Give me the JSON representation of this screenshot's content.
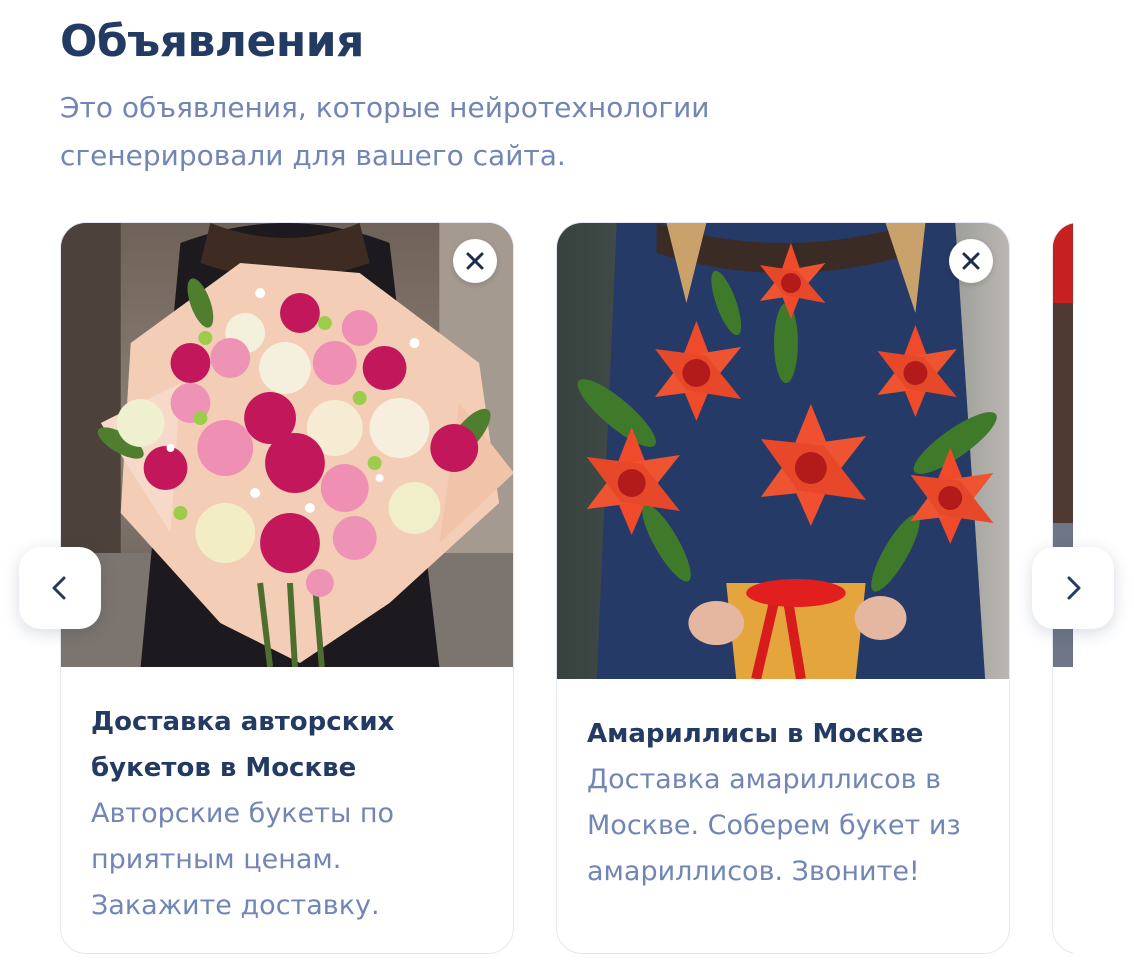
{
  "section": {
    "title": "Объявления",
    "description": "Это объявления, которые нейротехнологии сгенерировали для вашего сайта."
  },
  "ads": [
    {
      "image_icon": "roses-bouquet-image",
      "title": "Доставка авторских букетов в Москве",
      "text": "Авторские букеты по приятным ценам. Закажите доставку."
    },
    {
      "image_icon": "amaryllis-bouquet-image",
      "title": "Амариллисы в Москве",
      "text": "Доставка амариллисов в Москве. Соберем букет из амариллисов. Звоните!"
    }
  ],
  "controls": {
    "close_icon": "close-icon",
    "prev_icon": "chevron-left-icon",
    "next_icon": "chevron-right-icon"
  },
  "colors": {
    "heading": "#233a63",
    "muted_text": "#7286b6",
    "card_border": "#e3e8f2"
  }
}
